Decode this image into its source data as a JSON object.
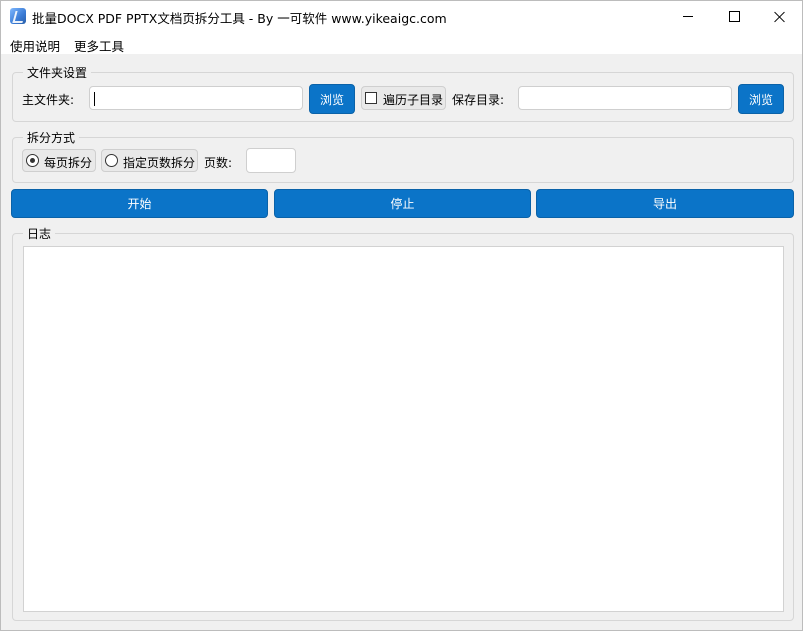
{
  "window": {
    "title": "批量DOCX PDF PPTX文档页拆分工具 - By 一可软件 www.yikeaigc.com",
    "controls": [
      "minimize",
      "maximize",
      "close"
    ]
  },
  "menu": {
    "usage": "使用说明",
    "more_tools": "更多工具"
  },
  "folder_settings": {
    "group_title": "文件夹设置",
    "main_folder_label": "主文件夹:",
    "main_folder_value": "",
    "browse_main_label": "浏览",
    "traverse_subdirs_label": "遍历子目录",
    "traverse_subdirs_checked": false,
    "save_dir_label": "保存目录:",
    "save_dir_value": "",
    "browse_save_label": "浏览"
  },
  "split_mode": {
    "group_title": "拆分方式",
    "per_page_label": "每页拆分",
    "per_page_selected": true,
    "specified_pages_label": "指定页数拆分",
    "specified_pages_selected": false,
    "page_count_label": "页数:",
    "page_count_value": ""
  },
  "actions": {
    "start_label": "开始",
    "stop_label": "停止",
    "export_label": "导出"
  },
  "log": {
    "group_title": "日志",
    "content": ""
  },
  "colors": {
    "accent": "#0b74c8",
    "window_bg": "#f0f0f0"
  }
}
